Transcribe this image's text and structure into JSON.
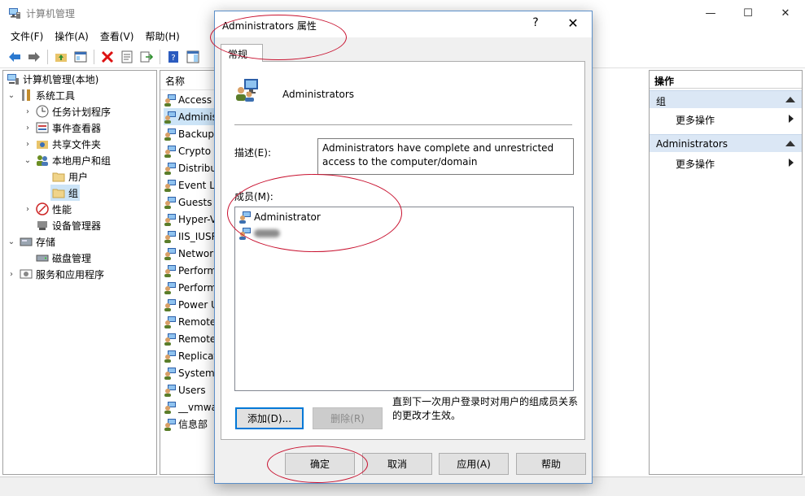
{
  "main_window": {
    "title": "计算机管理",
    "controls": {
      "minimize": "—",
      "maximize": "☐",
      "close": "✕"
    }
  },
  "menu": [
    "文件(F)",
    "操作(A)",
    "查看(V)",
    "帮助(H)"
  ],
  "tree": [
    {
      "label": "计算机管理(本地)",
      "icon": "computer-icon",
      "expander": ""
    },
    {
      "label": "系统工具",
      "icon": "tools-icon",
      "expander": "⌄"
    },
    {
      "label": "任务计划程序",
      "icon": "clock-icon",
      "expander": "›"
    },
    {
      "label": "事件查看器",
      "icon": "event-icon",
      "expander": "›"
    },
    {
      "label": "共享文件夹",
      "icon": "share-folder-icon",
      "expander": "›"
    },
    {
      "label": "本地用户和组",
      "icon": "users-icon",
      "expander": "⌄"
    },
    {
      "label": "用户",
      "icon": "folder-icon",
      "expander": ""
    },
    {
      "label": "组",
      "icon": "folder-icon",
      "expander": ""
    },
    {
      "label": "性能",
      "icon": "performance-icon",
      "expander": "›"
    },
    {
      "label": "设备管理器",
      "icon": "device-icon",
      "expander": ""
    },
    {
      "label": "存储",
      "icon": "storage-icon",
      "expander": "⌄"
    },
    {
      "label": "磁盘管理",
      "icon": "disk-icon",
      "expander": ""
    },
    {
      "label": "服务和应用程序",
      "icon": "services-icon",
      "expander": "›"
    }
  ],
  "list": {
    "header": "名称",
    "rows": [
      "Access",
      "Adminis",
      "Backup",
      "Crypto",
      "Distribu",
      "Event Lo",
      "Guests",
      "Hyper-V",
      "IIS_IUSR",
      "Networ",
      "Perform",
      "Perform",
      "Power U",
      "Remote",
      "Remote",
      "Replicat",
      "System",
      "Users",
      "__vmwa",
      "信息部"
    ]
  },
  "actions": {
    "title": "操作",
    "groups": [
      {
        "label": "组",
        "item": "更多操作"
      },
      {
        "label": "Administrators",
        "item": "更多操作"
      }
    ]
  },
  "dialog": {
    "title": "Administrators 属性",
    "help": "?",
    "close": "✕",
    "tab": "常规",
    "group_name": "Administrators",
    "description_label": "描述(E):",
    "description": "Administrators have complete and unrestricted access to the computer/domain",
    "members_label": "成员(M):",
    "members": [
      "Administrator"
    ],
    "add_button": "添加(D)...",
    "remove_button": "删除(R)",
    "note": "直到下一次用户登录时对用户的组成员关系的更改才生效。",
    "buttons": {
      "ok": "确定",
      "cancel": "取消",
      "apply": "应用(A)",
      "help": "帮助"
    }
  },
  "colors": {
    "accent": "#0078d7",
    "action_group_bg": "#dbe7f5",
    "annotation_red": "#c8102e"
  }
}
